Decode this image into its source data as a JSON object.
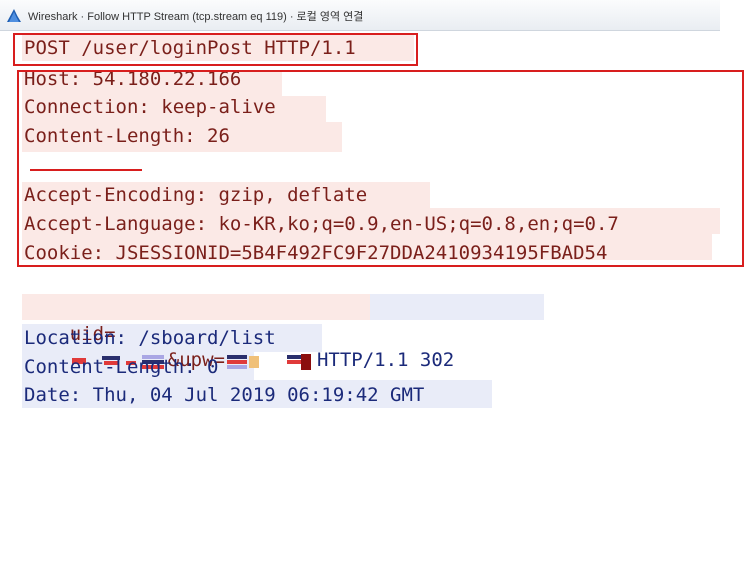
{
  "window": {
    "title": "Wireshark · Follow HTTP Stream (tcp.stream eq 119) · 로컬 영역 연결",
    "colors": {
      "request_text": "#7a1f1a",
      "request_bg": "#fbe9e6",
      "response_text": "#1b2a7a",
      "response_bg": "#e9ecf8",
      "highlight": "#d81e1e"
    }
  },
  "request": {
    "request_line": "POST /user/loginPost HTTP/1.1",
    "headers": [
      "Host: 54.180.22.166",
      "Connection: keep-alive",
      "Content-Length: 26",
      "Accept-Encoding: gzip, deflate",
      "Accept-Language: ko-KR,ko;q=0.9,en-US;q=0.8,en;q=0.7",
      "Cookie: JSESSIONID=5B4F492FC9F27DDA2410934195FBAD54"
    ],
    "body_prefix": "uid=",
    "body_mid": "&upw=",
    "redacted_note": "redacted-credentials"
  },
  "response": {
    "status": "HTTP/1.1 302",
    "headers": [
      "Location: /sboard/list",
      "Content-Length: 0",
      "Date: Thu, 04 Jul 2019 06:19:42 GMT"
    ]
  }
}
